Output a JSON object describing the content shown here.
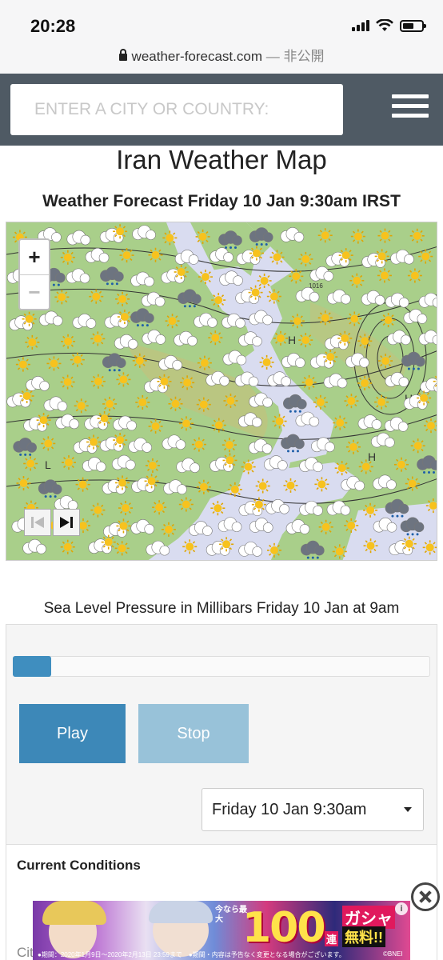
{
  "status_bar": {
    "time": "20:28",
    "url": "weather-forecast.com",
    "url_suffix": " — 非公開"
  },
  "header": {
    "search_placeholder": "ENTER A CITY OR COUNTRY:",
    "menu_icon": "hamburger-icon"
  },
  "page": {
    "title": "Iran Weather Map",
    "subtitle": "Weather Forecast Friday 10 Jan 9:30am IRST"
  },
  "map": {
    "zoom_in": "+",
    "zoom_out": "−",
    "isobar_label": "1016",
    "icons": [
      "sun-icon",
      "cloud-icon",
      "sun-cloud-icon",
      "rain-cloud-icon"
    ],
    "colors": {
      "land": "#a9cf8a",
      "sea": "#d9dcf0",
      "highland": "#c8bf7a"
    }
  },
  "caption": "Sea Level Pressure in Millibars Friday 10 Jan at 9am",
  "controls": {
    "progress": 0.08,
    "play_label": "Play",
    "stop_label": "Stop",
    "selected_time": "Friday 10 Jan 9:30am"
  },
  "current_conditions": {
    "label": "Current Conditions",
    "partial_text": "Cit"
  },
  "ad": {
    "small_text": "今なら最大",
    "number": "100",
    "unit": "連",
    "gacha": "ガシャ",
    "free": "無料!!",
    "note": "●期間：2020年1月9日～2020年2月13日 23:59まで　●期間・内容は予告なく変更となる場合がございます。",
    "brand": "©BNEI",
    "info": "i"
  }
}
